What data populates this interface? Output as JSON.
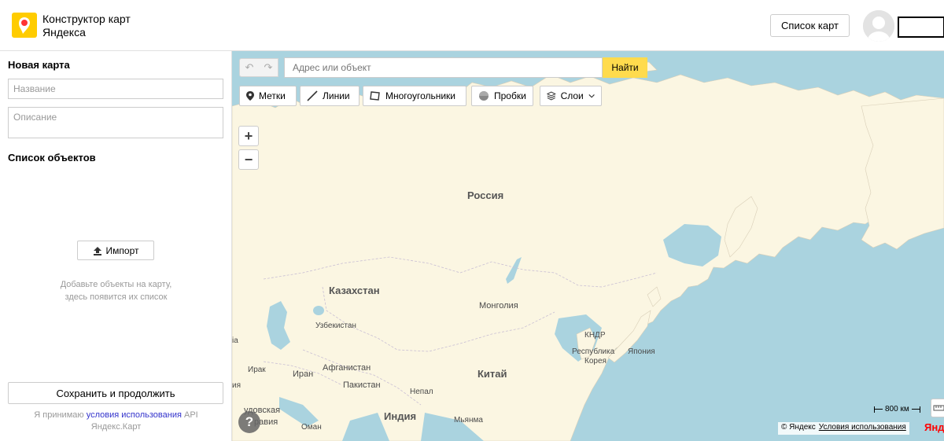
{
  "header": {
    "brand_line1": "Конструктор карт",
    "brand_line2": "Яндекса",
    "maps_list_button": "Список карт"
  },
  "sidebar": {
    "title": "Новая карта",
    "name_placeholder": "Название",
    "description_placeholder": "Описание",
    "objects_title": "Список объектов",
    "import_button": "Импорт",
    "empty_hint_line1": "Добавьте объекты на карту,",
    "empty_hint_line2": "здесь появится их список",
    "save_button": "Сохранить и продолжить",
    "terms_prefix": "Я принимаю",
    "terms_link": "условия использования",
    "terms_suffix": "API",
    "terms_line2": "Яндекс.Карт"
  },
  "map": {
    "search_placeholder": "Адрес или объект",
    "search_button": "Найти",
    "tools": {
      "placemarks": "Метки",
      "lines": "Линии",
      "polygons": "Многоугольники",
      "traffic": "Пробки",
      "layers": "Слои"
    },
    "labels": {
      "russia": "Россия",
      "kazakhstan": "Казахстан",
      "mongolia": "Монголия",
      "china": "Китай",
      "india": "Индия",
      "uzbekistan": "Узбекистан",
      "afghanistan": "Афганистан",
      "pakistan": "Пакистан",
      "iran": "Иран",
      "iraq": "Ирак",
      "nepal": "Непал",
      "myanmar": "Мьянма",
      "oman": "Оман",
      "saudi": "удовская",
      "saudi2": "равия",
      "dprk": "КНДР",
      "korea1": "Республика",
      "korea2": "Корея",
      "japan": "Япония",
      "edge1": "ia",
      "edge2": "ия"
    },
    "scale_label": "800 км",
    "copyright": "© Яндекс",
    "copyright_link": "Условия использования",
    "yandex_mark": "Янд"
  },
  "colors": {
    "water": "#aad3df",
    "land": "#fbf6e2",
    "accent_yellow": "#ffdb4d",
    "link_blue": "#3333cc"
  }
}
